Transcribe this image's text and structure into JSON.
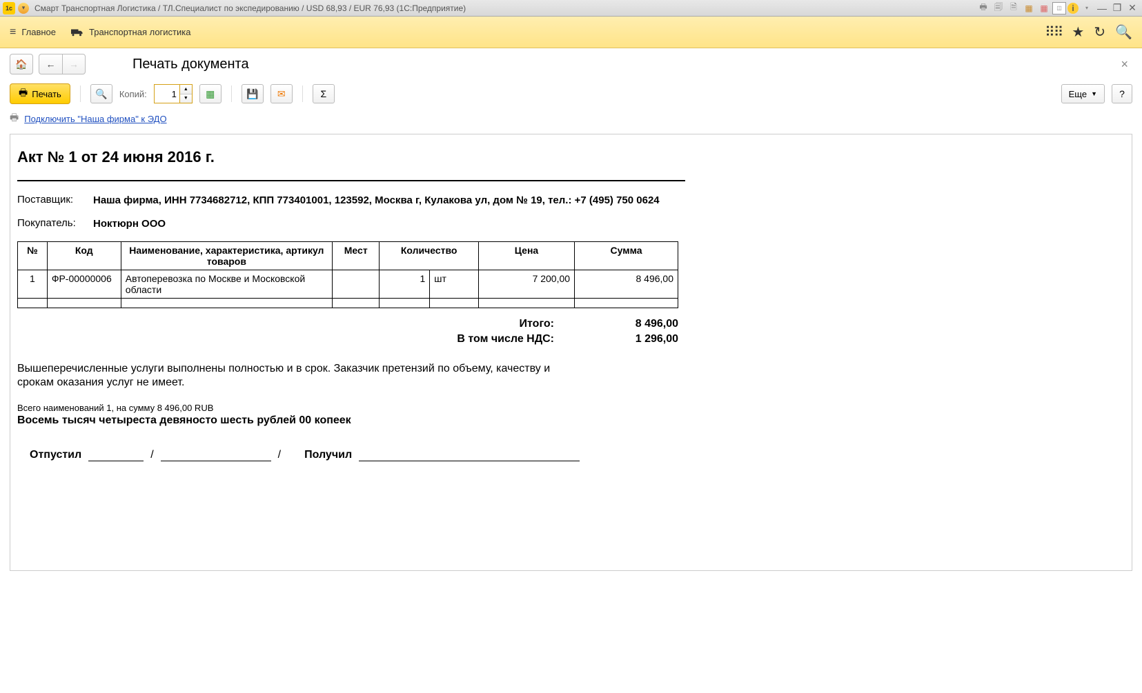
{
  "titlebar": {
    "text": "Смарт Транспортная Логистика / ТЛ.Специалист по экспедированию / USD 68,93 / EUR 76,93  (1С:Предприятие)"
  },
  "nav": {
    "main": "Главное",
    "logistics": "Транспортная логистика"
  },
  "page": {
    "title": "Печать документа"
  },
  "toolbar": {
    "print": "Печать",
    "copies_label": "Копий:",
    "copies_value": "1",
    "more": "Еще",
    "help": "?"
  },
  "edo": {
    "link": "Подключить \"Наша фирма\" к ЭДО"
  },
  "doc": {
    "title": "Акт № 1 от 24 июня 2016 г.",
    "supplier_label": "Поставщик:",
    "supplier_value": "Наша фирма,  ИНН 7734682712,  КПП 773401001,  123592, Москва г, Кулакова ул, дом № 19,  тел.: +7 (495) 750 0624",
    "buyer_label": "Покупатель:",
    "buyer_value": "Ноктюрн ООО",
    "headers": {
      "num": "№",
      "code": "Код",
      "name": "Наименование, характеристика, артикул товаров",
      "mest": "Мест",
      "qty": "Количество",
      "price": "Цена",
      "sum": "Сумма"
    },
    "rows": [
      {
        "num": "1",
        "code": "ФР-00000006",
        "name": "Автоперевозка по Москве и Московской области",
        "mest": "",
        "qty": "1",
        "unit": "шт",
        "price": "7 200,00",
        "sum": "8 496,00"
      }
    ],
    "total_label": "Итого:",
    "total_value": "8 496,00",
    "vat_label": "В том числе НДС:",
    "vat_value": "1 296,00",
    "disclaimer": "Вышеперечисленные услуги выполнены полностью и в срок. Заказчик претензий по объему, качеству и срокам оказания услуг не имеет.",
    "summary_small": "Всего наименований 1, на сумму 8 496,00 RUB",
    "summary_bold": "Восемь тысяч четыреста девяносто шесть рублей 00 копеек",
    "released": "Отпустил",
    "received": "Получил",
    "slash": "/"
  }
}
